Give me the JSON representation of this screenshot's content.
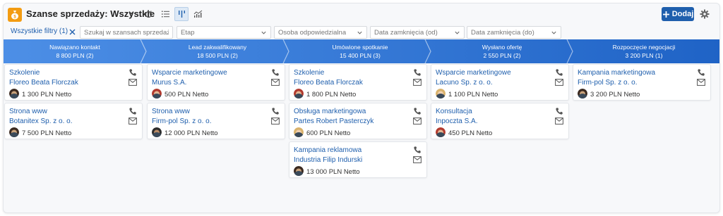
{
  "header": {
    "title": "Szanse sprzedaży: Wszystkie",
    "add_label": "Dodaj",
    "add_icon": "plus-icon"
  },
  "filters": {
    "all_filters_label": "Wszystkie filtry (1)",
    "search_placeholder": "Szukaj w szansach sprzedaży",
    "stage_placeholder": "Etap",
    "owner_placeholder": "Osoba odpowiedzialna",
    "close_from_placeholder": "Data zamknięcia (od)",
    "close_to_placeholder": "Data zamknięcia (do)"
  },
  "colors": {
    "stage_dark": "#1f63c6",
    "stage_light": "#4d8fe6",
    "link": "#1f5fad",
    "app_icon": "#f39c12"
  },
  "stages": [
    {
      "name": "Nawiązano kontakt",
      "summary": "8 800 PLN (2)"
    },
    {
      "name": "Lead zakwalifikowany",
      "summary": "18 500 PLN (2)"
    },
    {
      "name": "Umówione spotkanie",
      "summary": "15 400 PLN (3)"
    },
    {
      "name": "Wysłano ofertę",
      "summary": "2 550 PLN (2)"
    },
    {
      "name": "Rozpoczęcie negocjacji",
      "summary": "3 200 PLN (1)"
    }
  ],
  "columns": [
    {
      "cards": [
        {
          "title": "Szkolenie",
          "company": "Floreo Beata Florczak",
          "amount": "1 300 PLN Netto",
          "avatar": "man-dark"
        },
        {
          "title": "Strona www",
          "company": "Botanitex Sp. z o. o.",
          "amount": "7 500 PLN Netto",
          "avatar": "man-dark"
        }
      ]
    },
    {
      "cards": [
        {
          "title": "Wsparcie marketingowe",
          "company": "Murus S.A.",
          "amount": "500 PLN Netto",
          "avatar": "woman-red"
        },
        {
          "title": "Strona www",
          "company": "Firm-pol Sp. z o. o.",
          "amount": "12 000 PLN Netto",
          "avatar": "man-glasses"
        }
      ]
    },
    {
      "cards": [
        {
          "title": "Szkolenie",
          "company": "Floreo Beata Florczak",
          "amount": "1 800 PLN Netto",
          "avatar": "woman-red"
        },
        {
          "title": "Obsługa marketingowa",
          "company": "Partes Robert Pasterczyk",
          "amount": "600 PLN Netto",
          "avatar": "woman-blonde"
        },
        {
          "title": "Kampania reklamowa",
          "company": "Industria Filip Indurski",
          "amount": "13 000 PLN Netto",
          "avatar": "man-dark"
        }
      ]
    },
    {
      "cards": [
        {
          "title": "Wsparcie marketingowe",
          "company": "Lacuno Sp. z o. o.",
          "amount": "1 100 PLN Netto",
          "avatar": "woman-blonde"
        },
        {
          "title": "Konsultacja",
          "company": "Inpoczta S.A.",
          "amount": "450 PLN Netto",
          "avatar": "woman-red"
        }
      ]
    },
    {
      "cards": [
        {
          "title": "Kampania marketingowa",
          "company": "Firm-pol Sp. z o. o.",
          "amount": "3 200 PLN Netto",
          "avatar": "man-dark"
        }
      ]
    }
  ]
}
